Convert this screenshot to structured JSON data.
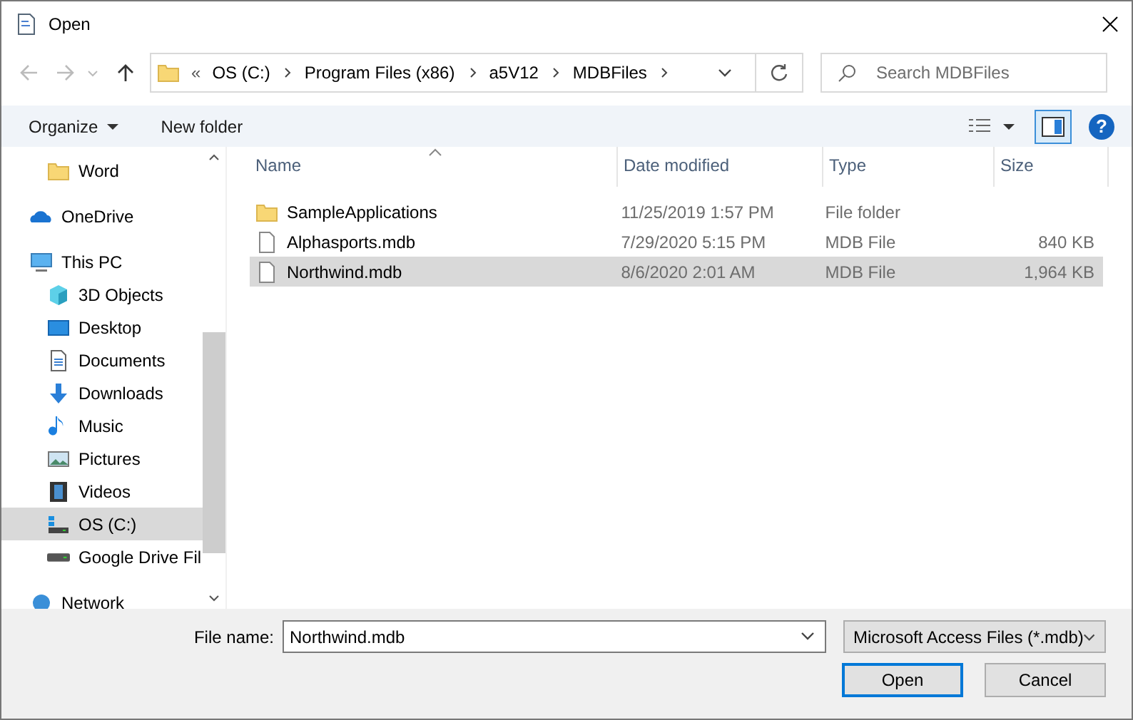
{
  "window": {
    "title": "Open"
  },
  "address": {
    "overflow": "«",
    "crumbs": [
      "OS (C:)",
      "Program Files (x86)",
      "a5V12",
      "MDBFiles"
    ]
  },
  "search": {
    "placeholder": "Search MDBFiles"
  },
  "toolbar": {
    "organize": "Organize",
    "new_folder": "New folder",
    "preview_pane_on": true,
    "help": "?"
  },
  "sidebar": {
    "continued_children": [
      {
        "label": "Word",
        "kind": "folder",
        "selected": false
      }
    ],
    "items": [
      {
        "label": "OneDrive",
        "kind": "cloud",
        "selected": false
      },
      {
        "label": "This PC",
        "kind": "pc",
        "selected": false,
        "children": [
          {
            "label": "3D Objects",
            "kind": "cube",
            "selected": false
          },
          {
            "label": "Desktop",
            "kind": "desktop",
            "selected": false
          },
          {
            "label": "Documents",
            "kind": "document",
            "selected": false
          },
          {
            "label": "Downloads",
            "kind": "download",
            "selected": false
          },
          {
            "label": "Music",
            "kind": "music",
            "selected": false
          },
          {
            "label": "Pictures",
            "kind": "pictures",
            "selected": false
          },
          {
            "label": "Videos",
            "kind": "videos",
            "selected": false
          },
          {
            "label": "OS (C:)",
            "kind": "os-drive",
            "selected": true
          },
          {
            "label": "Google Drive Fil",
            "kind": "drive",
            "selected": false
          }
        ]
      },
      {
        "label": "Network",
        "kind": "network",
        "selected": false
      }
    ]
  },
  "table": {
    "columns": [
      "Name",
      "Date modified",
      "Type",
      "Size"
    ],
    "rows": [
      {
        "kind": "folder",
        "name": "SampleApplications",
        "date": "11/25/2019 1:57 PM",
        "type": "File folder",
        "size": "",
        "selected": false
      },
      {
        "kind": "file",
        "name": "Alphasports.mdb",
        "date": "7/29/2020 5:15 PM",
        "type": "MDB File",
        "size": "840 KB",
        "selected": false
      },
      {
        "kind": "file",
        "name": "Northwind.mdb",
        "date": "8/6/2020 2:01 AM",
        "type": "MDB File",
        "size": "1,964 KB",
        "selected": true
      }
    ]
  },
  "footer": {
    "file_name_label": "File name:",
    "file_name": "Northwind.mdb",
    "filter": "Microsoft Access Files (*.mdb)",
    "buttons": [
      "Open",
      "Cancel"
    ]
  }
}
